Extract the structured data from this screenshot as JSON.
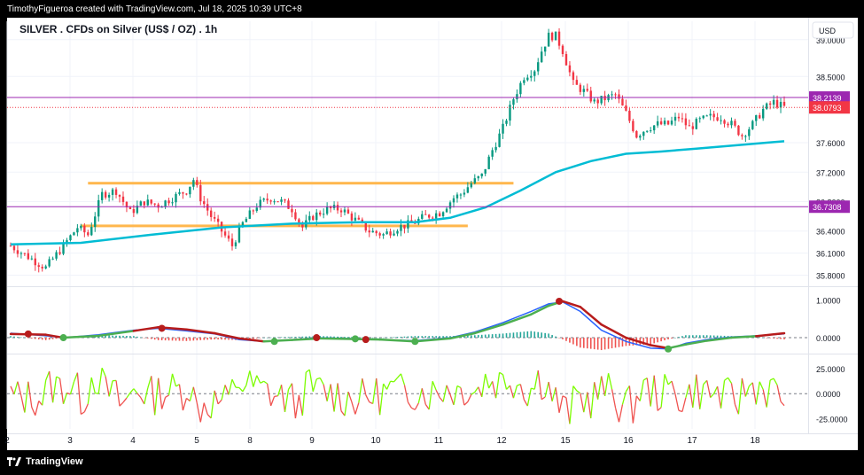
{
  "header": {
    "credit": "TimothyFigueroa created with TradingView.com, Jul 18, 2025 10:39 UTC+8"
  },
  "footer": {
    "brand": "TradingView"
  },
  "colors": {
    "background": "#ffffff",
    "grid": "#f0f3fa",
    "candle_up": "#089981",
    "candle_down": "#f23645",
    "ema": "#00bcd4",
    "level_purple": "#9c27b0",
    "zone_orange": "#ffb74d",
    "price_line": "#f23645",
    "macd_line": "#2962ff",
    "signal_up": "#4caf50",
    "signal_down": "#b71c1c",
    "hist_up": "#26a69a",
    "hist_down": "#ef5350",
    "osc_up": "#7cfc00",
    "osc_down": "#ef5350"
  },
  "chart_data": [
    {
      "type": "candlestick",
      "title": "SILVER . CFDs on Silver (US$ / OZ) . 1h",
      "currency": "USD",
      "y_ticks": [
        "39.0000",
        "38.5000",
        "37.6000",
        "37.2000",
        "36.8000",
        "36.4000",
        "36.1000",
        "35.8000"
      ],
      "y_range": [
        35.65,
        39.25
      ],
      "x_ticks": [
        "2",
        "3",
        "4",
        "5",
        "8",
        "9",
        "10",
        "11",
        "12",
        "15",
        "16",
        "17",
        "18"
      ],
      "price_path": [
        [
          0,
          36.2
        ],
        [
          5,
          36.05
        ],
        [
          10,
          35.9
        ],
        [
          15,
          36.2
        ],
        [
          19,
          36.45
        ],
        [
          22,
          36.35
        ],
        [
          26,
          36.9
        ],
        [
          30,
          36.95
        ],
        [
          34,
          36.65
        ],
        [
          38,
          36.8
        ],
        [
          42,
          36.75
        ],
        [
          46,
          36.85
        ],
        [
          50,
          36.95
        ],
        [
          52,
          37.1
        ],
        [
          54,
          36.85
        ],
        [
          57,
          36.6
        ],
        [
          60,
          36.4
        ],
        [
          63,
          36.2
        ],
        [
          66,
          36.5
        ],
        [
          70,
          36.75
        ],
        [
          74,
          36.85
        ],
        [
          77,
          36.8
        ],
        [
          80,
          36.7
        ],
        [
          83,
          36.45
        ],
        [
          86,
          36.6
        ],
        [
          90,
          36.7
        ],
        [
          94,
          36.7
        ],
        [
          98,
          36.55
        ],
        [
          102,
          36.4
        ],
        [
          106,
          36.35
        ],
        [
          110,
          36.45
        ],
        [
          114,
          36.5
        ],
        [
          118,
          36.6
        ],
        [
          122,
          36.65
        ],
        [
          126,
          36.85
        ],
        [
          128,
          36.9
        ],
        [
          131,
          37.05
        ],
        [
          134,
          37.15
        ],
        [
          137,
          37.5
        ],
        [
          140,
          37.8
        ],
        [
          143,
          38.2
        ],
        [
          146,
          38.5
        ],
        [
          149,
          38.6
        ],
        [
          151,
          38.85
        ],
        [
          153,
          39.05
        ],
        [
          155,
          39.05
        ],
        [
          157,
          38.85
        ],
        [
          160,
          38.4
        ],
        [
          163,
          38.3
        ],
        [
          166,
          38.15
        ],
        [
          169,
          38.2
        ],
        [
          172,
          38.25
        ],
        [
          175,
          38.0
        ],
        [
          178,
          37.7
        ],
        [
          181,
          37.8
        ],
        [
          184,
          37.85
        ],
        [
          187,
          37.85
        ],
        [
          190,
          37.95
        ],
        [
          193,
          37.8
        ],
        [
          196,
          37.9
        ],
        [
          199,
          37.95
        ],
        [
          202,
          37.95
        ],
        [
          205,
          37.85
        ],
        [
          208,
          37.7
        ],
        [
          211,
          37.85
        ],
        [
          214,
          38.05
        ],
        [
          217,
          38.15
        ],
        [
          220,
          38.08
        ]
      ],
      "ema_path": [
        [
          0,
          36.22
        ],
        [
          20,
          36.24
        ],
        [
          40,
          36.35
        ],
        [
          60,
          36.45
        ],
        [
          80,
          36.5
        ],
        [
          100,
          36.52
        ],
        [
          115,
          36.52
        ],
        [
          125,
          36.58
        ],
        [
          135,
          36.72
        ],
        [
          145,
          36.95
        ],
        [
          155,
          37.2
        ],
        [
          165,
          37.35
        ],
        [
          175,
          37.45
        ],
        [
          185,
          37.48
        ],
        [
          195,
          37.52
        ],
        [
          205,
          37.56
        ],
        [
          215,
          37.6
        ],
        [
          220,
          37.62
        ]
      ],
      "levels": [
        {
          "label": "38.2139",
          "value": 38.2139,
          "color": "#9c27b0"
        },
        {
          "label": "36.7308",
          "value": 36.7308,
          "color": "#9c27b0"
        }
      ],
      "current_price": {
        "label": "38.0793",
        "value": 38.0793
      },
      "zones": [
        {
          "value": 37.05,
          "from": 22,
          "to": 143,
          "color": "#ffb74d"
        },
        {
          "value": 36.47,
          "from": 20,
          "to": 130,
          "color": "#ffb74d"
        }
      ]
    },
    {
      "type": "line",
      "name": "macd",
      "y_ticks": [
        "1.0000",
        "0.0000"
      ],
      "y_range": [
        -0.4,
        1.3
      ],
      "macd": [
        [
          0,
          0.12
        ],
        [
          10,
          0.05
        ],
        [
          15,
          0.0
        ],
        [
          25,
          0.08
        ],
        [
          35,
          0.2
        ],
        [
          42,
          0.25
        ],
        [
          50,
          0.18
        ],
        [
          58,
          0.1
        ],
        [
          65,
          -0.05
        ],
        [
          72,
          -0.1
        ],
        [
          80,
          -0.05
        ],
        [
          88,
          0.0
        ],
        [
          95,
          -0.02
        ],
        [
          105,
          -0.05
        ],
        [
          115,
          -0.08
        ],
        [
          125,
          0.0
        ],
        [
          132,
          0.15
        ],
        [
          140,
          0.4
        ],
        [
          148,
          0.7
        ],
        [
          153,
          0.9
        ],
        [
          157,
          0.95
        ],
        [
          162,
          0.7
        ],
        [
          168,
          0.2
        ],
        [
          175,
          -0.1
        ],
        [
          182,
          -0.28
        ],
        [
          187,
          -0.3
        ],
        [
          192,
          -0.15
        ],
        [
          198,
          -0.05
        ],
        [
          205,
          0.02
        ],
        [
          212,
          0.05
        ],
        [
          220,
          0.1
        ]
      ],
      "signal": [
        [
          0,
          0.1
        ],
        [
          10,
          0.08
        ],
        [
          15,
          0.0
        ],
        [
          25,
          0.05
        ],
        [
          35,
          0.18
        ],
        [
          42,
          0.28
        ],
        [
          50,
          0.22
        ],
        [
          58,
          0.12
        ],
        [
          65,
          -0.02
        ],
        [
          72,
          -0.1
        ],
        [
          80,
          -0.06
        ],
        [
          88,
          -0.02
        ],
        [
          95,
          -0.03
        ],
        [
          105,
          -0.05
        ],
        [
          115,
          -0.1
        ],
        [
          125,
          -0.02
        ],
        [
          132,
          0.12
        ],
        [
          140,
          0.35
        ],
        [
          148,
          0.62
        ],
        [
          153,
          0.85
        ],
        [
          157,
          0.97
        ],
        [
          162,
          0.82
        ],
        [
          168,
          0.35
        ],
        [
          175,
          0.0
        ],
        [
          182,
          -0.2
        ],
        [
          187,
          -0.28
        ],
        [
          192,
          -0.18
        ],
        [
          198,
          -0.08
        ],
        [
          205,
          0.0
        ],
        [
          212,
          0.04
        ],
        [
          220,
          0.12
        ]
      ],
      "cross_points": [
        {
          "x": 5,
          "y": 0.1,
          "state": "down"
        },
        {
          "x": 15,
          "y": 0.0,
          "state": "up"
        },
        {
          "x": 43,
          "y": 0.25,
          "state": "down"
        },
        {
          "x": 75,
          "y": -0.1,
          "state": "up"
        },
        {
          "x": 87,
          "y": 0.0,
          "state": "down"
        },
        {
          "x": 98,
          "y": -0.03,
          "state": "up"
        },
        {
          "x": 101,
          "y": -0.05,
          "state": "down"
        },
        {
          "x": 115,
          "y": -0.1,
          "state": "up"
        },
        {
          "x": 156,
          "y": 0.97,
          "state": "down"
        },
        {
          "x": 187,
          "y": -0.3,
          "state": "up"
        }
      ]
    },
    {
      "type": "line",
      "name": "oscillator",
      "y_ticks": [
        "25.0000",
        "0.0000",
        "-25.0000"
      ],
      "y_range": [
        -35,
        38
      ]
    }
  ]
}
